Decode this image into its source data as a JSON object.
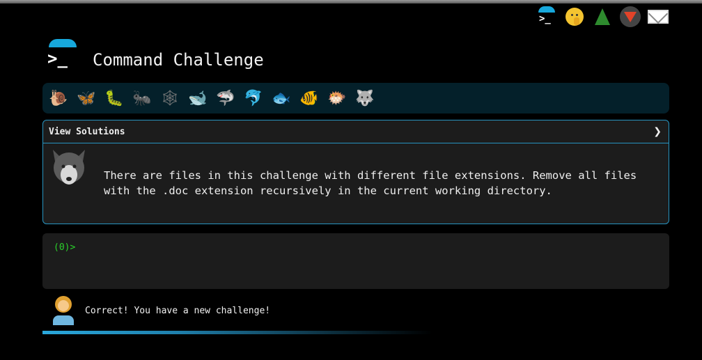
{
  "header": {
    "title": "Command Challenge",
    "logo_glyph": ">_",
    "top_icons": [
      "terminal-icon",
      "shushing-face-icon",
      "tree-icon",
      "gitlab-icon",
      "mail-icon"
    ]
  },
  "animals": [
    {
      "name": "snail",
      "glyph": "🐌"
    },
    {
      "name": "butterfly",
      "glyph": "🦋"
    },
    {
      "name": "caterpillar",
      "glyph": "🐛"
    },
    {
      "name": "ant",
      "glyph": "🐜"
    },
    {
      "name": "spider-web",
      "glyph": "🕸"
    },
    {
      "name": "whale",
      "glyph": "🐋"
    },
    {
      "name": "shark",
      "glyph": "🦈"
    },
    {
      "name": "dolphin",
      "glyph": "🐬"
    },
    {
      "name": "fish",
      "glyph": "🐟"
    },
    {
      "name": "tropical-fish",
      "glyph": "🐠"
    },
    {
      "name": "blowfish",
      "glyph": "🐡"
    },
    {
      "name": "wolf",
      "glyph": "🐺"
    }
  ],
  "solutions": {
    "label": "View Solutions",
    "chevron": "❯",
    "challenge_text": "There are files in this challenge with different file extensions. Remove all files with the .doc extension recursively in the current working directory."
  },
  "terminal": {
    "prompt": "(0)>"
  },
  "feedback": {
    "message": "Correct! You have a new challenge!"
  },
  "progress": {
    "fraction": 1.0
  },
  "colors": {
    "accent": "#2795c2",
    "prompt": "#2bd12b",
    "panel": "#1c1c1c",
    "animal_bar": "#04202a"
  }
}
